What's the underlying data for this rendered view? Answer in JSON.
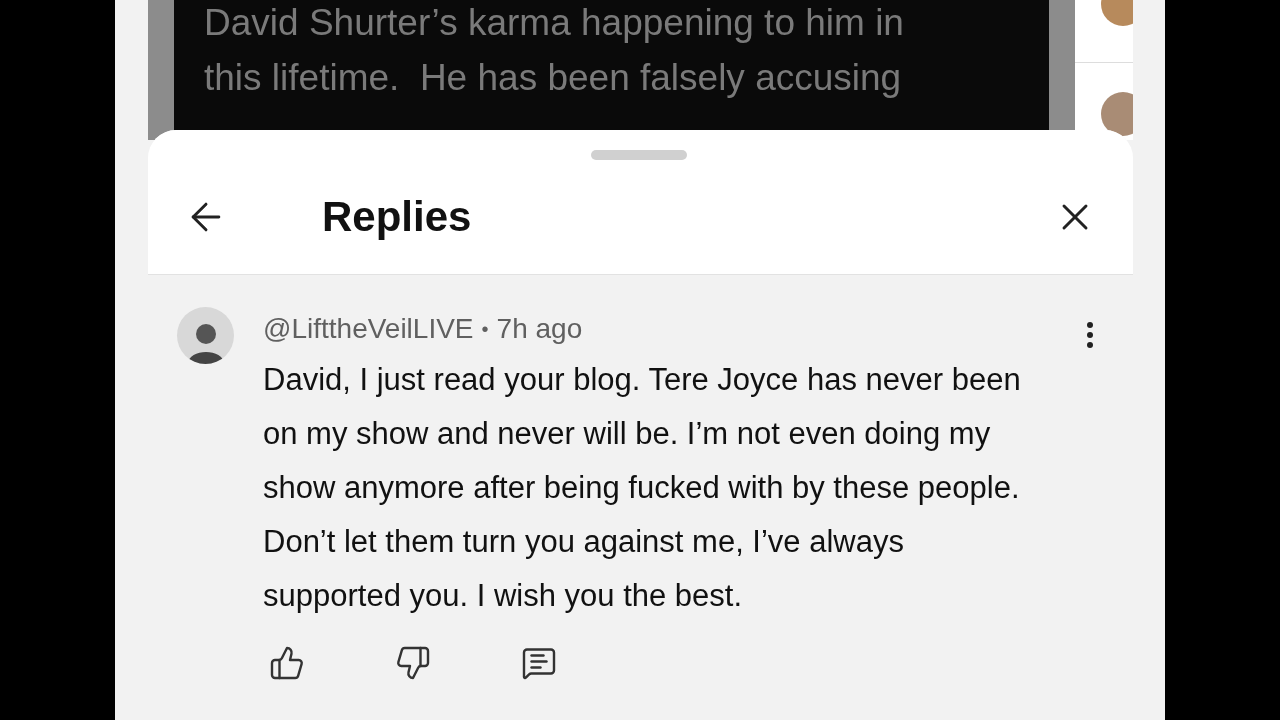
{
  "background_post": {
    "lines": [
      "David Shurter’s karma happening to him in",
      "this lifetime.  He has been falsely accusing"
    ]
  },
  "replies_sheet": {
    "title": "Replies",
    "comment": {
      "author": "@LifttheVeilLIVE",
      "separator": "•",
      "time": "7h ago",
      "text": "David, I just read your blog. Tere Joyce has never been on my show and never will be. I’m not even doing my show anymore after being fucked with by these people. Don’t let them turn you against me, I’ve always supported you. I wish you the best."
    }
  }
}
